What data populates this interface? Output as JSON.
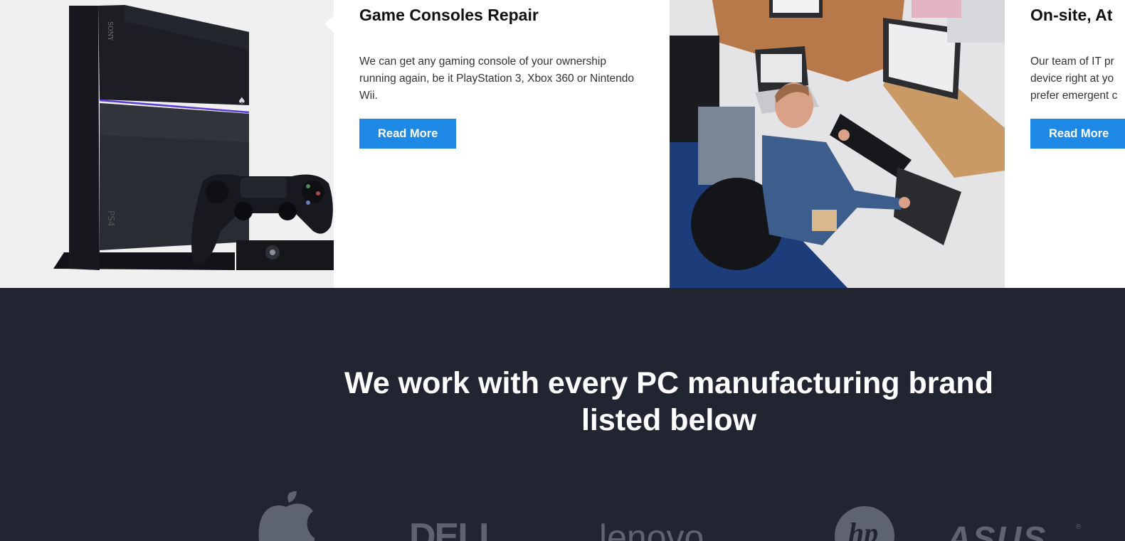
{
  "services": {
    "cards": [
      {
        "title": "Game Consoles Repair",
        "description": "We can get any gaming console of your ownership running again, be it PlayStation 3, Xbox 360 or Nintendo Wii.",
        "button": "Read More"
      },
      {
        "title": "On-site, At",
        "description": "Our team of IT pr device right at yo prefer emergent c",
        "button": "Read More"
      }
    ]
  },
  "console_photo": {
    "brand_text": "SONY",
    "model_text": "PS4"
  },
  "brands": {
    "heading": "We work with every PC manufacturing brand listed below",
    "logos": [
      {
        "name": "Apple",
        "icon": "apple-logo-icon"
      },
      {
        "name": "DELL",
        "icon": "dell-logo-icon"
      },
      {
        "name": "lenovo",
        "icon": "lenovo-logo-icon"
      },
      {
        "name": "hp",
        "icon": "hp-logo-icon"
      },
      {
        "name": "ASUS",
        "icon": "asus-logo-icon"
      }
    ]
  },
  "colors": {
    "accent": "#1e88e5",
    "brands_background": "#212532",
    "logo_gray": "#5d6370"
  }
}
